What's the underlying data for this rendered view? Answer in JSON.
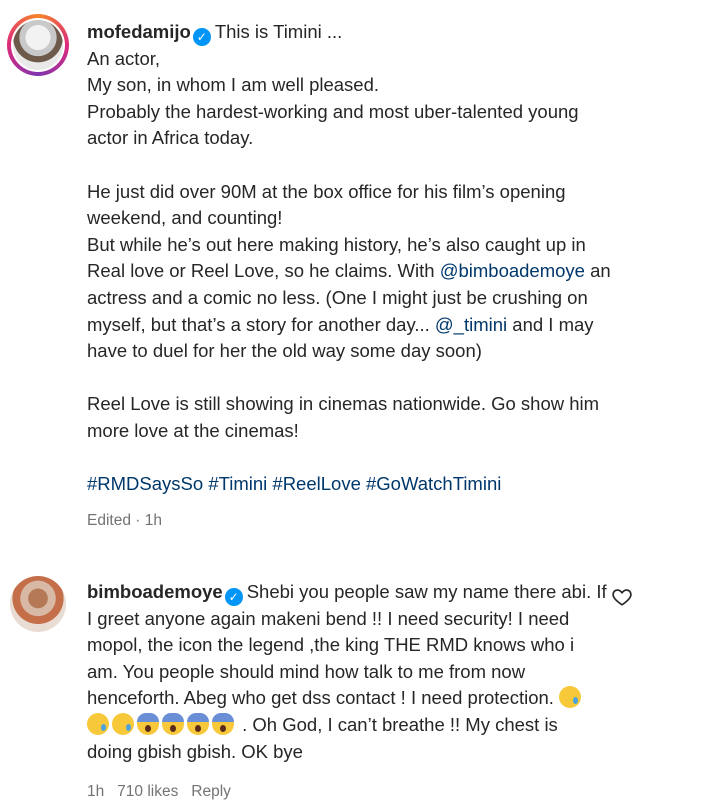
{
  "post": {
    "username": "mofedamijo",
    "title_text": "This is Timini ...",
    "lines": [
      "An actor,",
      "My son, in whom I am well pleased.",
      "Probably the hardest-working and most uber-talented young",
      "actor in Africa today.",
      "He just did over 90M at the box office for his film’s opening",
      "weekend, and counting!",
      "But while he’s out here making history, he’s also caught up in",
      "Real love or Reel Love, so he claims. With ",
      "@bimboademoye",
      " an",
      "actress and a comic no less. (One I might just be crushing on",
      "myself, but that’s a story for another day... ",
      "@_timini",
      " and I may",
      "have to duel for her the old way some day soon)",
      "Reel Love is still showing in cinemas nationwide. Go show him",
      "more love at the cinemas!"
    ],
    "hashtags": [
      "#RMDSaysSo",
      "#Timini",
      "#ReelLove",
      "#GoWatchTimini"
    ],
    "meta": "Edited · 1h"
  },
  "comment": {
    "username": "bimboademoye",
    "lines": [
      "Shebi you people saw my name there abi. If",
      "I greet anyone again makeni bend !! I need security! I need",
      "mopol, the icon the legend ,the king THE RMD knows who i",
      "am. You people should mind how talk to me from now",
      "henceforth. Abeg who get dss contact ! I need protection.",
      ". Oh God, I can’t breathe !! My chest is",
      "doing gbish gbish. OK bye"
    ],
    "time": "1h",
    "likes": "710 likes",
    "reply": "Reply"
  },
  "icons": {
    "verified": "verified-badge-icon",
    "heart": "heart-outline-icon",
    "emoji_cry": "crying-face-emoji",
    "emoji_scream": "screaming-face-emoji"
  },
  "colors": {
    "text": "#262626",
    "link": "#00376b",
    "meta": "#737373",
    "verified": "#0095f6"
  }
}
